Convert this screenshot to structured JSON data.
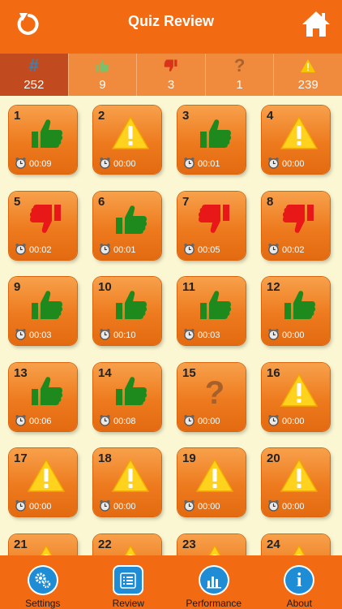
{
  "header": {
    "title": "Quiz Review"
  },
  "stats": [
    {
      "icon": "hash-icon",
      "value": "252"
    },
    {
      "icon": "thumbs-up-icon",
      "value": "9"
    },
    {
      "icon": "thumbs-down-icon",
      "value": "3"
    },
    {
      "icon": "question-mark-icon",
      "value": "1"
    },
    {
      "icon": "warning-icon",
      "value": "239"
    }
  ],
  "questions": [
    {
      "number": "1",
      "status": "correct",
      "time": "00:09"
    },
    {
      "number": "2",
      "status": "skipped",
      "time": "00:00"
    },
    {
      "number": "3",
      "status": "correct",
      "time": "00:01"
    },
    {
      "number": "4",
      "status": "skipped",
      "time": "00:00"
    },
    {
      "number": "5",
      "status": "wrong",
      "time": "00:02"
    },
    {
      "number": "6",
      "status": "correct",
      "time": "00:01"
    },
    {
      "number": "7",
      "status": "wrong",
      "time": "00:05"
    },
    {
      "number": "8",
      "status": "wrong",
      "time": "00:02"
    },
    {
      "number": "9",
      "status": "correct",
      "time": "00:03"
    },
    {
      "number": "10",
      "status": "correct",
      "time": "00:10"
    },
    {
      "number": "11",
      "status": "correct",
      "time": "00:03"
    },
    {
      "number": "12",
      "status": "correct",
      "time": "00:00"
    },
    {
      "number": "13",
      "status": "correct",
      "time": "00:06"
    },
    {
      "number": "14",
      "status": "correct",
      "time": "00:08"
    },
    {
      "number": "15",
      "status": "unsure",
      "time": "00:00"
    },
    {
      "number": "16",
      "status": "skipped",
      "time": "00:00"
    },
    {
      "number": "17",
      "status": "skipped",
      "time": "00:00"
    },
    {
      "number": "18",
      "status": "skipped",
      "time": "00:00"
    },
    {
      "number": "19",
      "status": "skipped",
      "time": "00:00"
    },
    {
      "number": "20",
      "status": "skipped",
      "time": "00:00"
    },
    {
      "number": "21",
      "status": "skipped",
      "time": ""
    },
    {
      "number": "22",
      "status": "skipped",
      "time": ""
    },
    {
      "number": "23",
      "status": "skipped",
      "time": ""
    },
    {
      "number": "24",
      "status": "skipped",
      "time": ""
    }
  ],
  "tabs": [
    {
      "label": "Settings",
      "icon": "gear-icon"
    },
    {
      "label": "Review",
      "icon": "list-icon"
    },
    {
      "label": "Performance",
      "icon": "bar-chart-icon"
    },
    {
      "label": "About",
      "icon": "info-icon"
    }
  ],
  "colors": {
    "accent": "#F26A11",
    "active_stat": "#C14A1E",
    "background": "#FBF7D2",
    "thumb_up": "#1E8A1E",
    "thumb_down": "#E81818",
    "tab_icon": "#1F8DD6"
  }
}
